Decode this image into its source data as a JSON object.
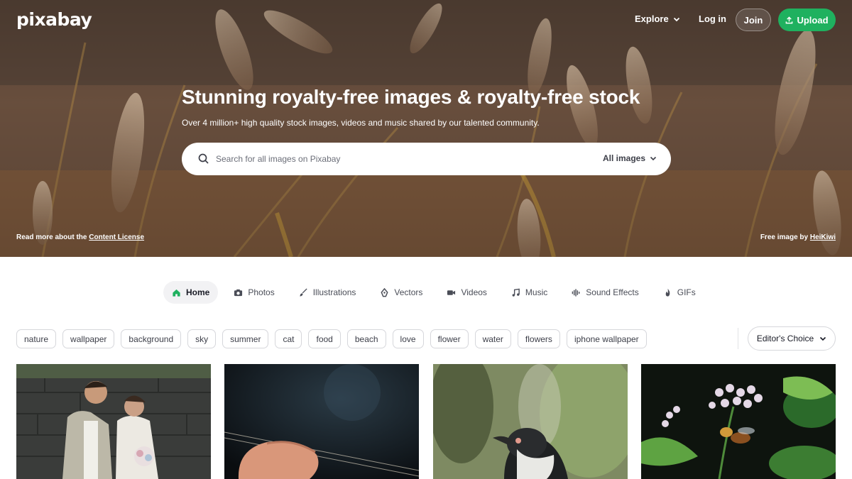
{
  "brand": {
    "logo": "pixabay"
  },
  "nav": {
    "explore": "Explore",
    "login": "Log in",
    "join": "Join",
    "upload": "Upload"
  },
  "hero": {
    "title": "Stunning royalty-free images & royalty-free stock",
    "subtitle": "Over 4 million+ high quality stock images, videos and music shared by our talented community.",
    "search_placeholder": "Search for all images on Pixabay",
    "search_filter": "All images",
    "license_prefix": "Read more about the",
    "license_link": "Content License",
    "credit_prefix": "Free image by",
    "credit_author": "HeiKiwi"
  },
  "tabs": [
    {
      "label": "Home",
      "icon": "home-icon",
      "active": true
    },
    {
      "label": "Photos",
      "icon": "camera-icon"
    },
    {
      "label": "Illustrations",
      "icon": "brush-icon"
    },
    {
      "label": "Vectors",
      "icon": "pen-nib-icon"
    },
    {
      "label": "Videos",
      "icon": "video-camera-icon"
    },
    {
      "label": "Music",
      "icon": "music-note-icon"
    },
    {
      "label": "Sound Effects",
      "icon": "waveform-icon"
    },
    {
      "label": "GIFs",
      "icon": "flame-icon"
    }
  ],
  "tags": [
    "nature",
    "wallpaper",
    "background",
    "sky",
    "summer",
    "cat",
    "food",
    "beach",
    "love",
    "flower",
    "water",
    "flowers",
    "iphone wallpaper"
  ],
  "sort": {
    "label": "Editor's Choice"
  },
  "colors": {
    "accent": "#1fb15f",
    "text": "#191b26"
  },
  "photos": [
    {
      "subject": "wedding couple"
    },
    {
      "subject": "hand on strings"
    },
    {
      "subject": "penguin"
    },
    {
      "subject": "bee on flower"
    }
  ]
}
